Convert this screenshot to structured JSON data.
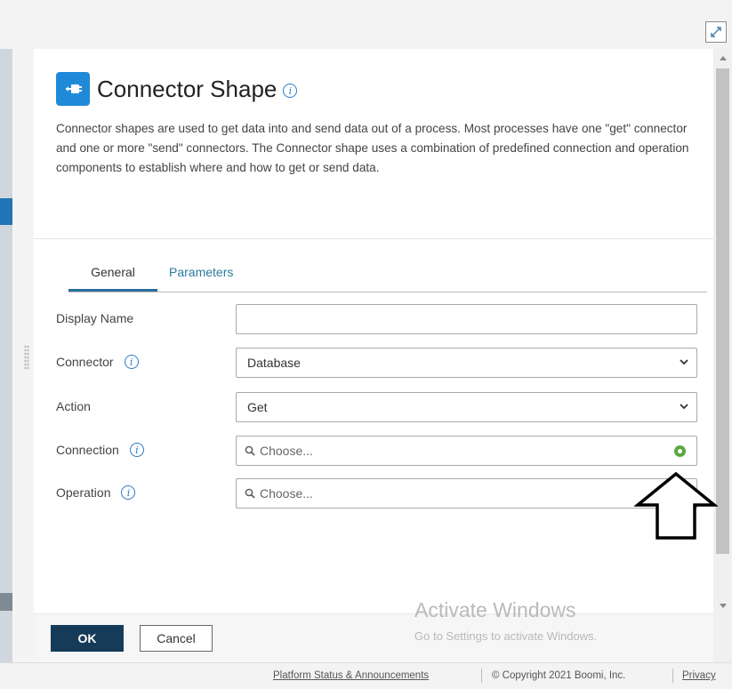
{
  "header": {
    "title": "Connector Shape"
  },
  "description": "Connector shapes are used to get data into and send data out of a process. Most processes have one \"get\" connector and one or more \"send\" connectors. The Connector shape uses a combination of predefined connection and operation components to establish where and how to get or send data.",
  "tabs": [
    {
      "label": "General",
      "active": true
    },
    {
      "label": "Parameters",
      "active": false
    }
  ],
  "form": {
    "display_name": {
      "label": "Display Name",
      "value": ""
    },
    "connector": {
      "label": "Connector",
      "value": "Database"
    },
    "action": {
      "label": "Action",
      "value": "Get"
    },
    "connection": {
      "label": "Connection",
      "placeholder": "Choose..."
    },
    "operation": {
      "label": "Operation",
      "placeholder": "Choose..."
    }
  },
  "buttons": {
    "ok": "OK",
    "cancel": "Cancel"
  },
  "watermark": {
    "line1": "Activate Windows",
    "line2": "Go to Settings to activate Windows."
  },
  "footer": {
    "status_link": "Platform Status & Announcements",
    "copyright": "© Copyright 2021 Boomi, Inc.",
    "privacy": "Privacy"
  },
  "icons": {
    "title_icon": "connector-icon",
    "info": "info-icon",
    "expand": "expand-icon",
    "search": "search-icon",
    "add": "add-icon",
    "chevron": "chevron-down-icon"
  },
  "colors": {
    "accent": "#1f8ad8",
    "primary_button": "#153b59",
    "tab_link": "#2a7a9e",
    "add_green": "#5aa840"
  }
}
